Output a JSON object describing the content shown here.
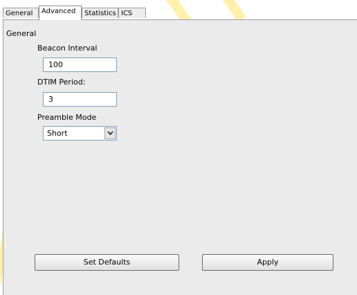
{
  "tabs": [
    "General",
    "Advanced",
    "Statistics",
    "ICS"
  ],
  "active_tab": "Advanced",
  "group": {
    "title": "General"
  },
  "fields": {
    "beacon_interval": {
      "label": "Beacon Interval",
      "value": "100"
    },
    "dtim_period": {
      "label": "DTIM Period:",
      "value": "3"
    },
    "preamble_mode": {
      "label": "Preamble Mode",
      "value": "Short"
    }
  },
  "buttons": {
    "set_defaults": "Set Defaults",
    "apply": "Apply"
  },
  "icons": {
    "dropdown": "chevron-down-icon"
  },
  "colors": {
    "panel_bg": "#ebebeb",
    "input_border": "#7f9db9",
    "watermark": "#ffe566"
  }
}
